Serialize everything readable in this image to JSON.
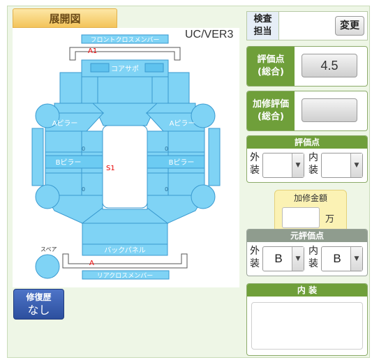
{
  "left": {
    "title": "展開図",
    "version": "UC/VER3",
    "diagram": {
      "front_cross_member": "フロントクロスメンバー",
      "core_support": "コアサポ",
      "a_pillar_left": "Aピラー",
      "a_pillar_right": "Aピラー",
      "b_pillar_left": "Bピラー",
      "b_pillar_right": "Bピラー",
      "back_panel": "バックパネル",
      "rear_cross_member": "リアクロスメンバー",
      "spare": "スペア",
      "mark_a1": "A1",
      "mark_s1": "S1",
      "mark_a": "A",
      "zero": "0"
    },
    "repair_history": {
      "label": "修復歴",
      "value": "なし"
    }
  },
  "right": {
    "inspector": {
      "label_line1": "検査",
      "label_line2": "担当",
      "change_button": "変更"
    },
    "overall_score": {
      "label_line1": "評価点",
      "label_line2": "(総合)",
      "value": "4.5"
    },
    "repair_score": {
      "label_line1": "加修評価",
      "label_line2": "(総合)",
      "value": ""
    },
    "score": {
      "header": "評価点",
      "exterior_label_1": "外",
      "exterior_label_2": "装",
      "exterior_value": "",
      "interior_label_1": "内",
      "interior_label_2": "装",
      "interior_value": ""
    },
    "repair_fee": {
      "label": "加修金額",
      "value": "",
      "unit": "万"
    },
    "original_score": {
      "header": "元評価点",
      "exterior_label_1": "外",
      "exterior_label_2": "装",
      "exterior_value": "B",
      "interior_label_1": "内",
      "interior_label_2": "装",
      "interior_value": "B"
    },
    "interior_notes": {
      "header": "内 装",
      "value": ""
    }
  },
  "colors": {
    "panel_fill": "#7fd3f5",
    "panel_stroke": "#3a9ad0",
    "green_header": "#6f9f3a",
    "mark_red": "#e60000"
  }
}
